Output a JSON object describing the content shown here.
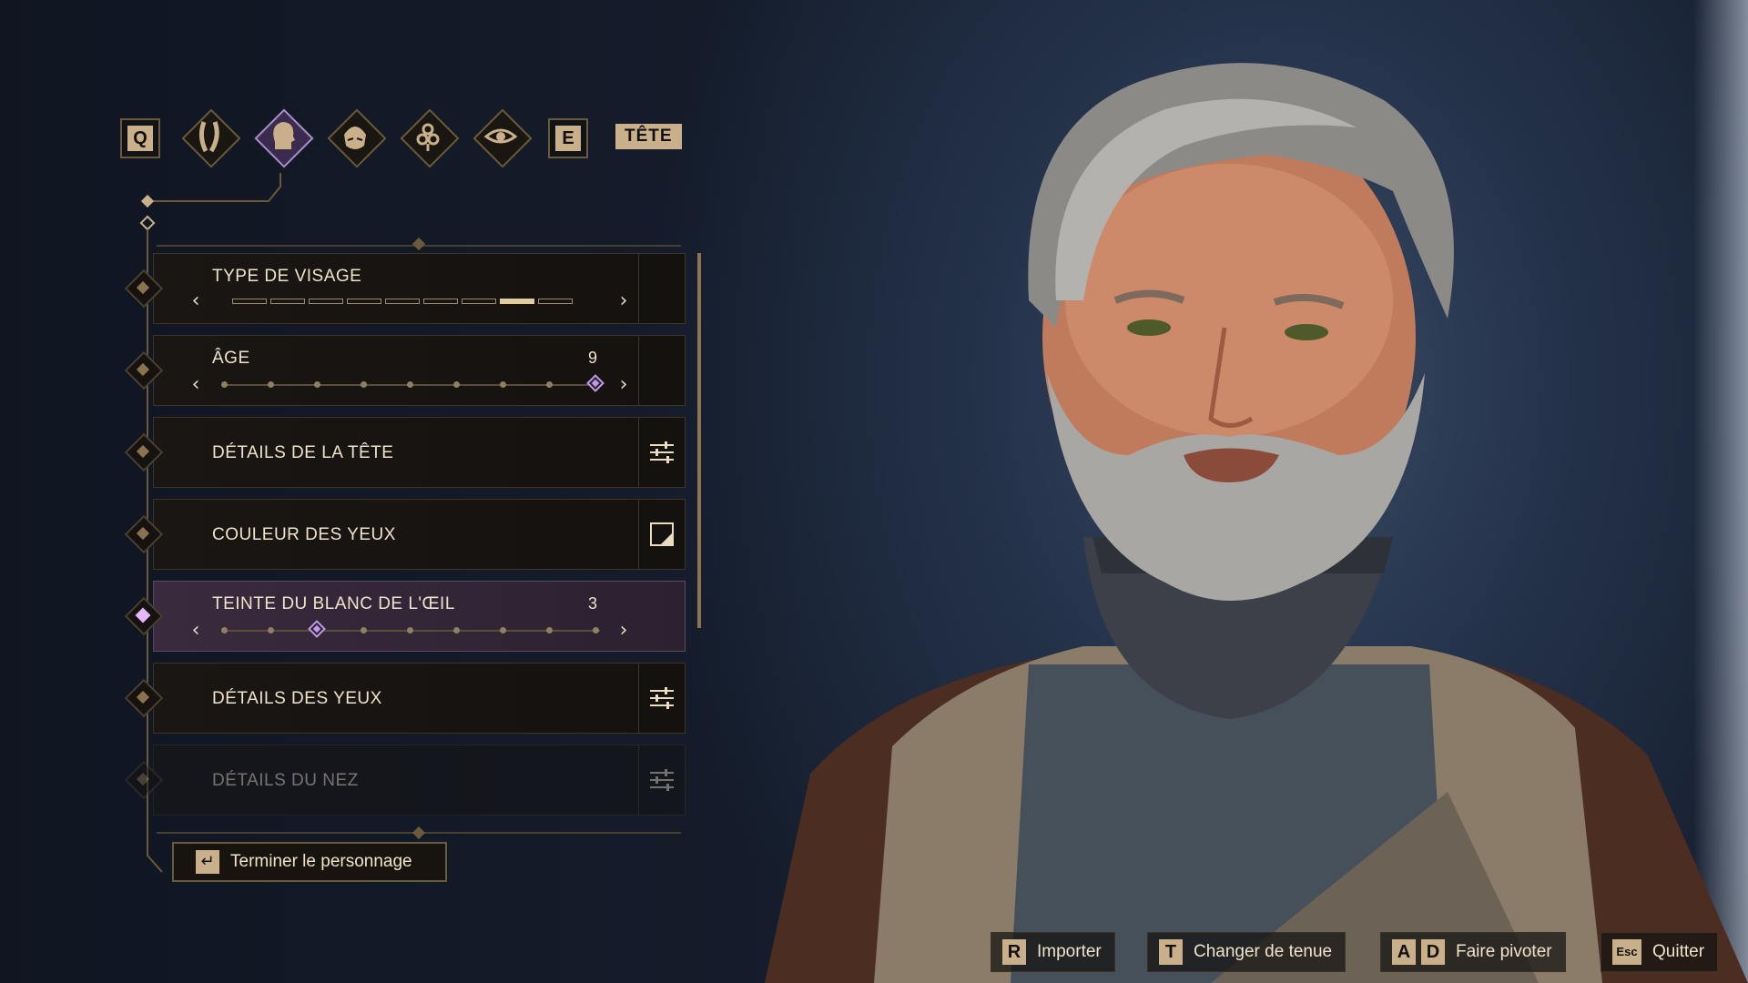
{
  "category_bar": {
    "prev_key": "Q",
    "next_key": "E",
    "tab_title": "TÊTE",
    "categories": [
      {
        "icon": "body-silhouette-icon",
        "active": false
      },
      {
        "icon": "head-profile-icon",
        "active": true
      },
      {
        "icon": "face-hair-icon",
        "active": false
      },
      {
        "icon": "ornament-knot-icon",
        "active": false
      },
      {
        "icon": "eye-icon",
        "active": false
      }
    ]
  },
  "options": [
    {
      "label": "TYPE DE VISAGE",
      "kind": "segments",
      "segments": 9,
      "selected": 8
    },
    {
      "label": "ÂGE",
      "kind": "slider",
      "value": "9",
      "steps": 9,
      "position": 9
    },
    {
      "label": "DÉTAILS DE LA TÊTE",
      "kind": "submenu",
      "icon": "sliders-icon"
    },
    {
      "label": "COULEUR DES YEUX",
      "kind": "color",
      "icon": "color-swatch-icon"
    },
    {
      "label": "TEINTE DU BLANC DE L'ŒIL",
      "kind": "slider",
      "value": "3",
      "steps": 9,
      "position": 3,
      "highlighted": true
    },
    {
      "label": "DÉTAILS DES YEUX",
      "kind": "submenu",
      "icon": "sliders-icon"
    },
    {
      "label": "DÉTAILS DU NEZ",
      "kind": "submenu",
      "icon": "sliders-icon",
      "faded": true
    }
  ],
  "finish_button": {
    "key_icon": "enter-key-icon",
    "label": "Terminer le personnage"
  },
  "hints": [
    {
      "keys": [
        "R"
      ],
      "label": "Importer"
    },
    {
      "keys": [
        "T"
      ],
      "label": "Changer de tenue"
    },
    {
      "keys": [
        "A",
        "D"
      ],
      "label": "Faire pivoter"
    },
    {
      "keys": [
        "Esc"
      ],
      "label": "Quitter"
    }
  ],
  "colors": {
    "accent_gold": "#c9b08a",
    "selection_purple": "#c29ae6",
    "highlight_row": "#3a2a3e"
  }
}
